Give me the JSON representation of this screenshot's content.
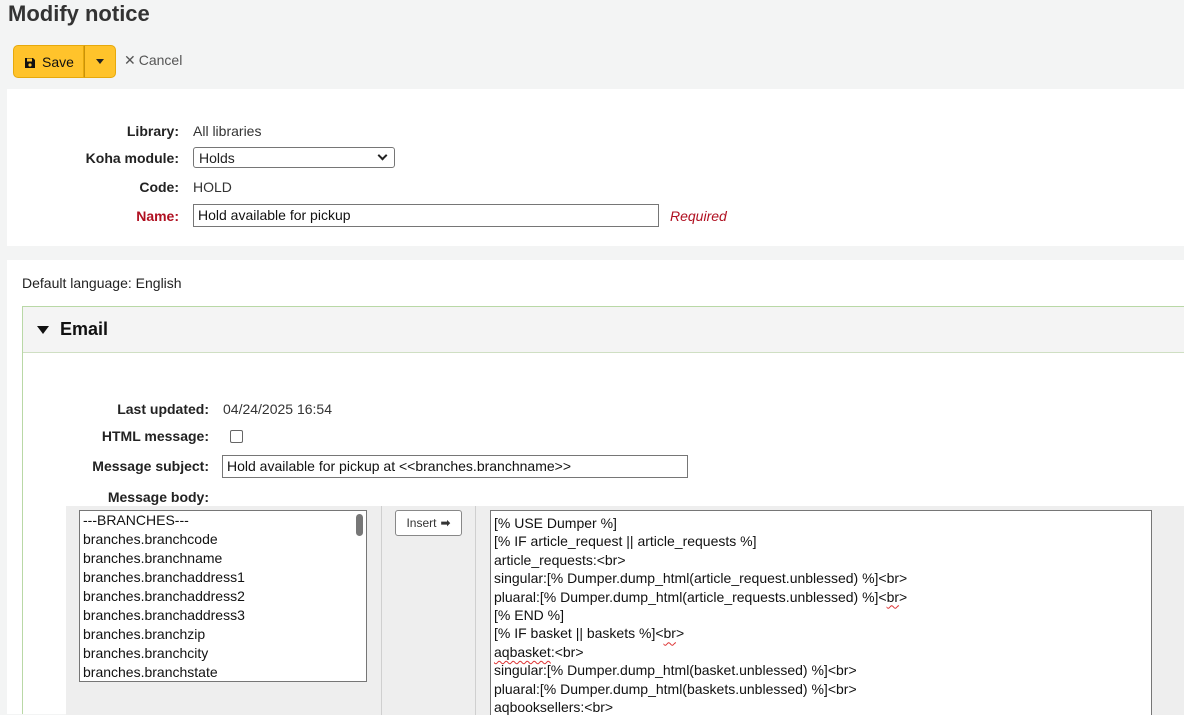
{
  "page": {
    "title": "Modify notice"
  },
  "toolbar": {
    "save_label": "Save",
    "cancel_label": "Cancel"
  },
  "notice": {
    "library_label": "Library:",
    "library_value": "All libraries",
    "module_label": "Koha module:",
    "module_value": "Holds",
    "code_label": "Code:",
    "code_value": "HOLD",
    "name_label": "Name:",
    "name_value": "Hold available for pickup",
    "name_required": "Required"
  },
  "default_language": {
    "label": "Default language:",
    "value": "English"
  },
  "email": {
    "heading": "Email",
    "last_updated_label": "Last updated:",
    "last_updated_value": "04/24/2025 16:54",
    "html_message_label": "HTML message:",
    "html_message_checked": false,
    "subject_label": "Message subject:",
    "subject_value": "Hold available for pickup at <<branches.branchname>>",
    "body_label": "Message body:",
    "insert_label": "Insert",
    "fields": [
      "---BRANCHES---",
      "branches.branchcode",
      "branches.branchname",
      "branches.branchaddress1",
      "branches.branchaddress2",
      "branches.branchaddress3",
      "branches.branchzip",
      "branches.branchcity",
      "branches.branchstate"
    ],
    "body_lines": [
      [
        "[% USE Dumper %]"
      ],
      [
        "[% IF article_request || article_requests %]"
      ],
      [
        "article_requests:<br>"
      ],
      [
        "singular:[% Dumper.dump_html(article_request.unblessed) %]<br>"
      ],
      [
        "pluaral:[% Dumper.dump_html(article_requests.unblessed) %]<",
        "br",
        ">"
      ],
      [
        "[% END %]"
      ],
      [
        "[% IF basket || baskets %]<",
        "br",
        ">"
      ],
      [
        "",
        "aqbasket",
        ":<br>"
      ],
      [
        "singular:[% Dumper.dump_html(basket.unblessed) %]<br>"
      ],
      [
        "pluaral:[% Dumper.dump_html(baskets.unblessed) %]<br>"
      ],
      [
        "",
        "aqbooksellers",
        ":<br>"
      ]
    ]
  }
}
